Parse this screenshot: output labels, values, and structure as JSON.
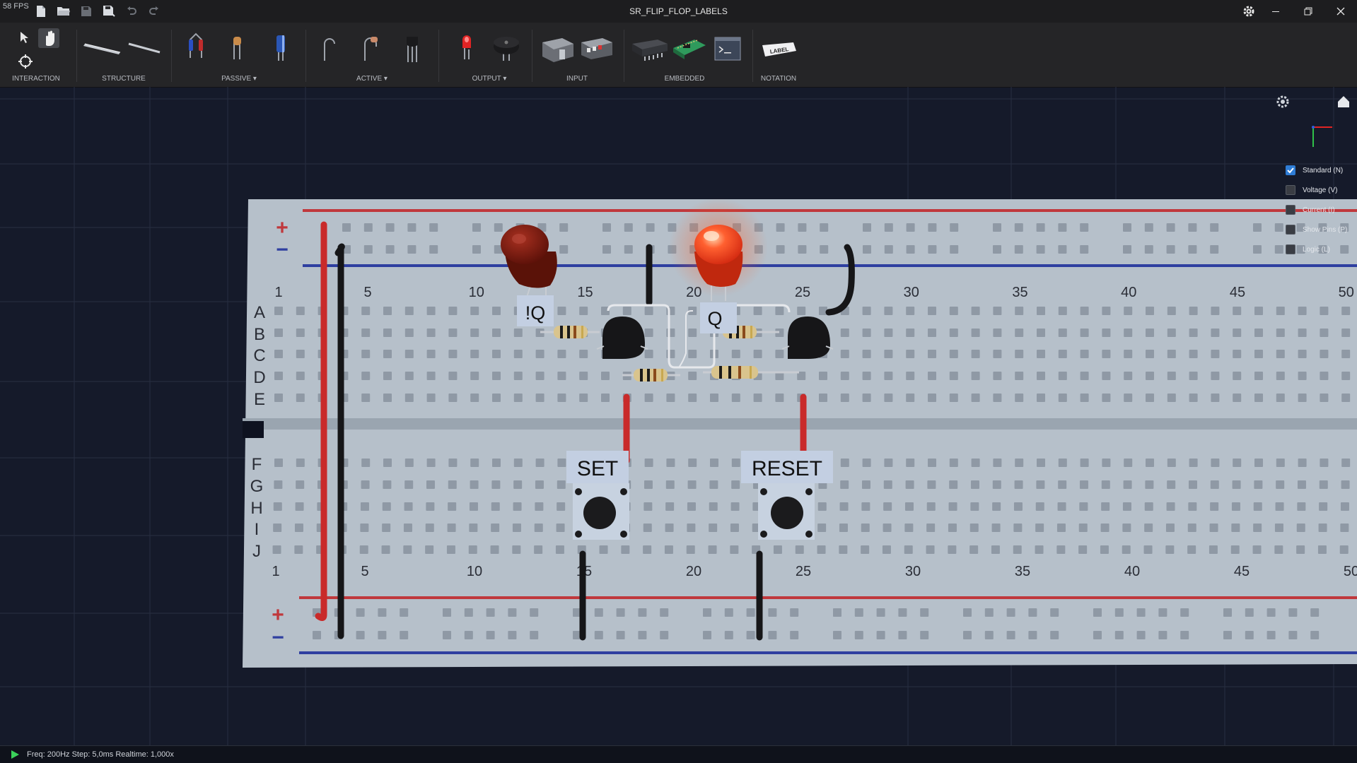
{
  "window": {
    "fps": "58 FPS",
    "title": "SR_FLIP_FLOP_LABELS"
  },
  "toolbar": {
    "groups": [
      {
        "label": "INTERACTION"
      },
      {
        "label": "STRUCTURE"
      },
      {
        "label": "PASSIVE",
        "dropdown": true
      },
      {
        "label": "ACTIVE",
        "dropdown": true
      },
      {
        "label": "OUTPUT",
        "dropdown": true
      },
      {
        "label": "INPUT"
      },
      {
        "label": "EMBEDDED"
      },
      {
        "label": "NOTATION"
      }
    ],
    "label_tool_text": "LABEL"
  },
  "view_toggles": [
    {
      "label": "Standard (N)",
      "checked": true
    },
    {
      "label": "Voltage (V)",
      "checked": false
    },
    {
      "label": "Current (I)",
      "checked": false
    },
    {
      "label": "Show Pins (P)",
      "checked": false
    },
    {
      "label": "Logic (L)",
      "checked": false
    }
  ],
  "breadboard": {
    "rail_plus": "+",
    "rail_minus": "−",
    "row_letters_top": [
      "A",
      "B",
      "C",
      "D",
      "E"
    ],
    "row_letters_bottom": [
      "F",
      "G",
      "H",
      "I",
      "J"
    ],
    "column_numbers": [
      "1",
      "5",
      "10",
      "15",
      "20",
      "25",
      "30",
      "35",
      "40",
      "45",
      "50"
    ]
  },
  "labels": {
    "not_q": "!Q",
    "q": "Q",
    "set": "SET",
    "reset": "RESET"
  },
  "leds": {
    "not_q_state": "off",
    "q_state": "on"
  },
  "status": {
    "text": "Freq: 200Hz  Step: 5,0ms Realtime: 1,000x"
  },
  "colors": {
    "background": "#151a2a",
    "breadboard": "#b5bfc8",
    "rail_red": "#c0383c",
    "rail_blue": "#2f3fa0",
    "led_on": "#ff4a20",
    "led_off": "#7a1810",
    "checkbox_on": "#2f7dd6"
  }
}
